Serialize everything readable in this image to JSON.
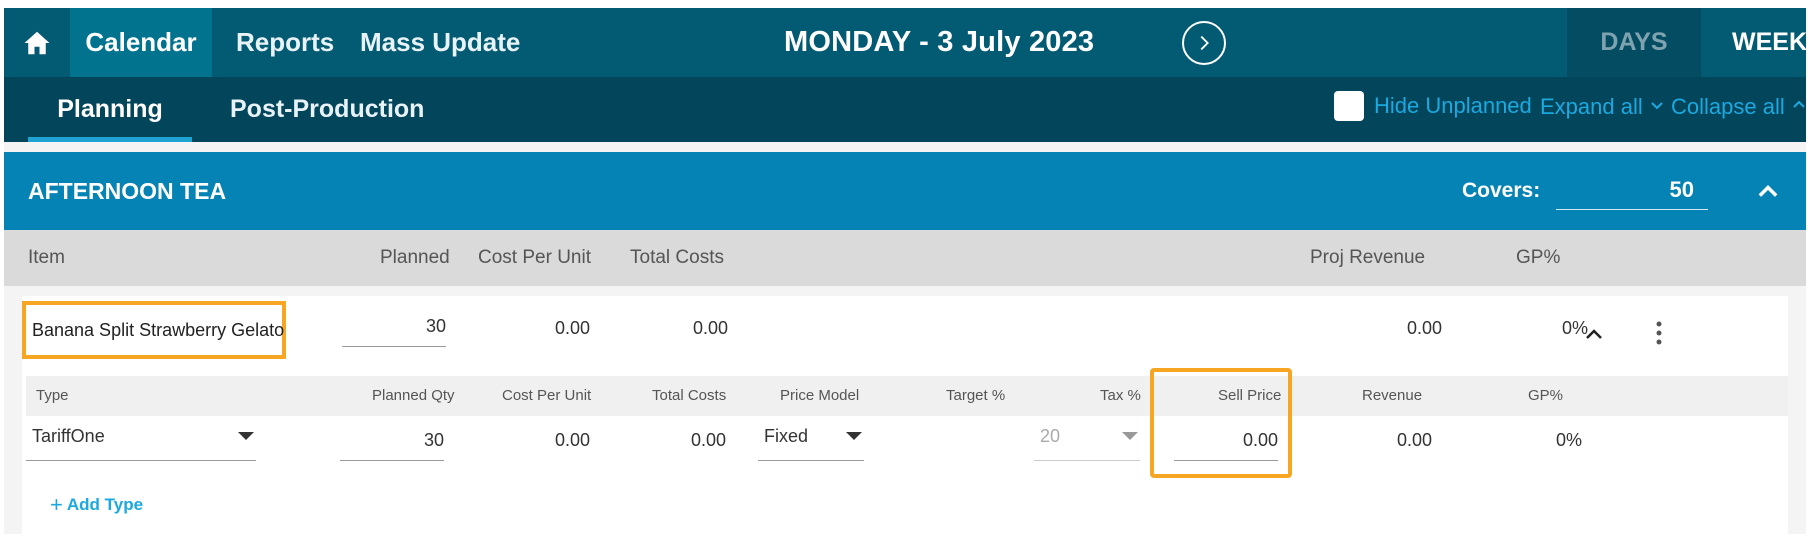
{
  "topbar": {
    "nav": [
      "Calendar",
      "Reports",
      "Mass Update"
    ],
    "date_title": "MONDAY - 3 July 2023",
    "view_days": "DAYS",
    "view_weeks": "WEEKS"
  },
  "subnav": {
    "tabs": [
      "Planning",
      "Post-Production"
    ],
    "hide_unplanned": "Hide Unplanned",
    "expand_all": "Expand all",
    "collapse_all": "Collapse all"
  },
  "section": {
    "title": "AFTERNOON TEA",
    "covers_label": "Covers:",
    "covers_value": "50"
  },
  "columns": [
    "Item",
    "Planned",
    "Cost Per Unit",
    "Total Costs",
    "Proj Revenue",
    "GP%"
  ],
  "item": {
    "name": "Banana Split Strawberry Gelato",
    "planned": "30",
    "cost_per_unit": "0.00",
    "total_costs": "0.00",
    "proj_revenue": "0.00",
    "gp": "0%"
  },
  "type_columns": [
    "Type",
    "Planned Qty",
    "Cost Per Unit",
    "Total Costs",
    "Price Model",
    "Target %",
    "Tax %",
    "Sell Price",
    "Revenue",
    "GP%"
  ],
  "type_row": {
    "type": "TariffOne",
    "planned_qty": "30",
    "cost_per_unit": "0.00",
    "total_costs": "0.00",
    "price_model": "Fixed",
    "tax": "20",
    "sell_price": "0.00",
    "revenue": "0.00",
    "gp": "0%"
  },
  "add_type_label": "Add Type",
  "colors": {
    "topbar": "#035a73",
    "subbar": "#03455a",
    "section": "#0583b4",
    "accent_link": "#1ba9e0",
    "highlight": "#f6a623"
  }
}
